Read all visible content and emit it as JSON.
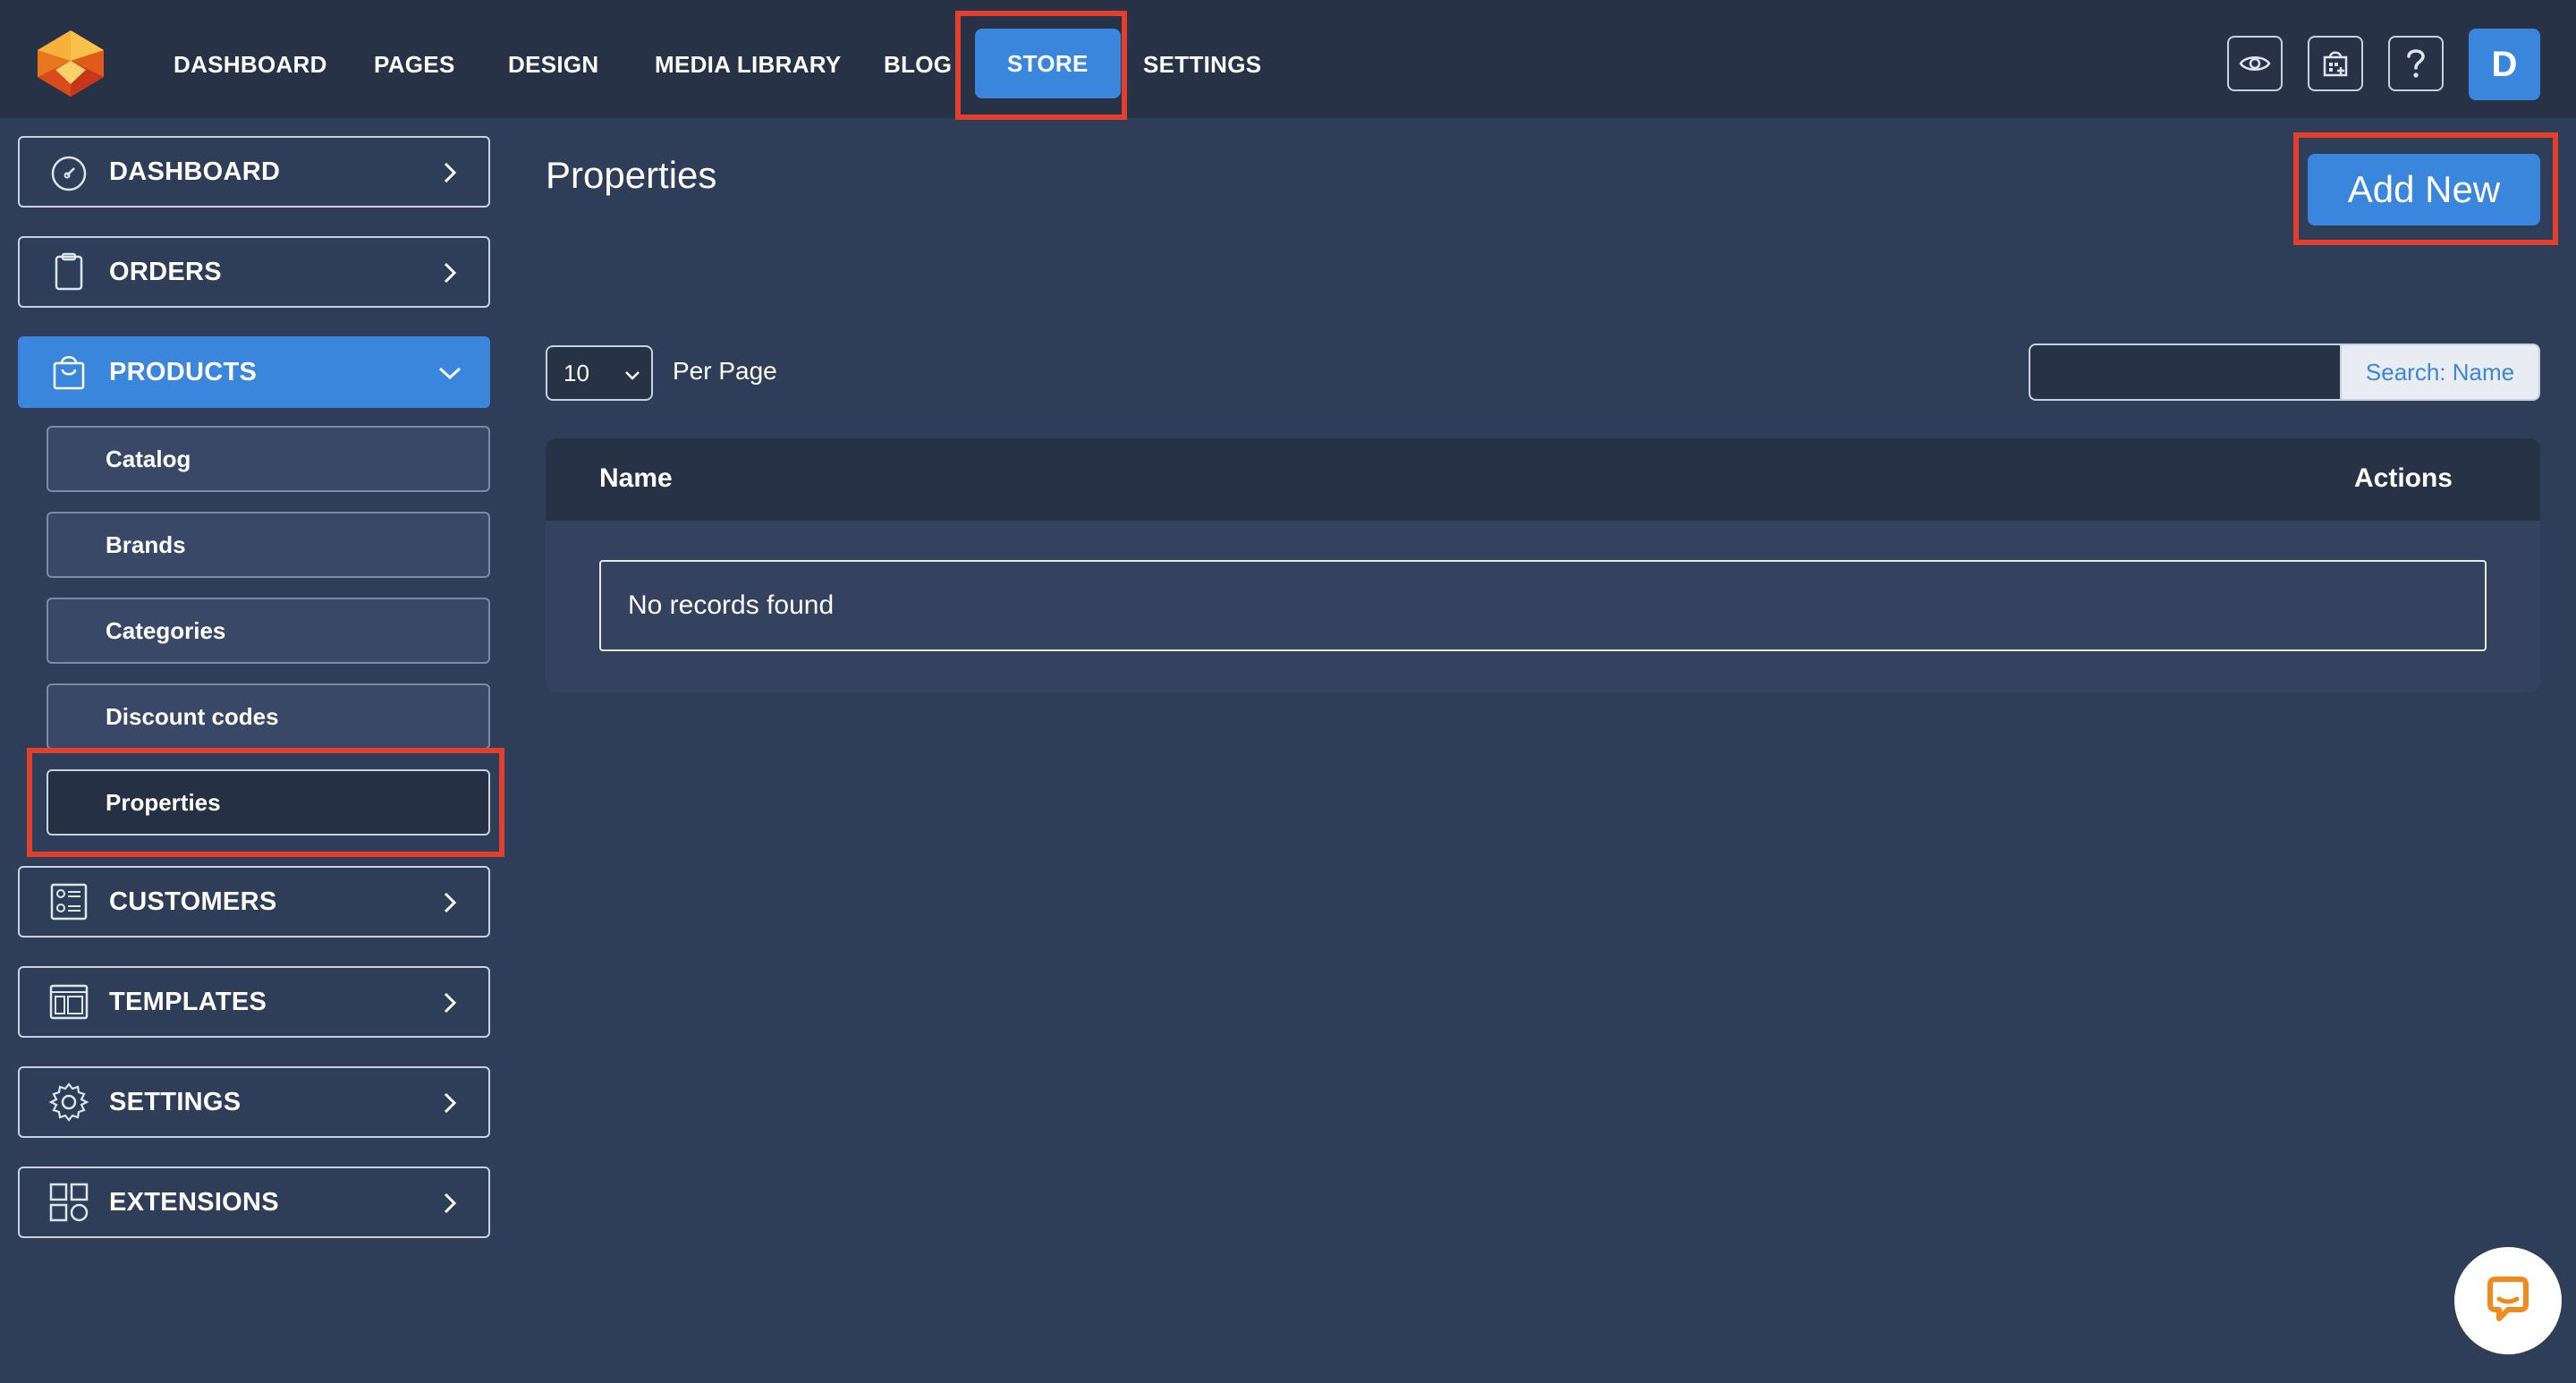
{
  "topnav": {
    "items": [
      {
        "label": "DASHBOARD"
      },
      {
        "label": "PAGES"
      },
      {
        "label": "DESIGN"
      },
      {
        "label": "MEDIA LIBRARY"
      },
      {
        "label": "BLOG"
      },
      {
        "label": "STORE",
        "active": true
      },
      {
        "label": "SETTINGS"
      }
    ],
    "icons": [
      "eye-icon",
      "store-calendar-icon",
      "help-icon"
    ],
    "avatar_initial": "D"
  },
  "sidebar": {
    "items": [
      {
        "label": "DASHBOARD",
        "icon": "gauge-icon"
      },
      {
        "label": "ORDERS",
        "icon": "clipboard-icon"
      },
      {
        "label": "PRODUCTS",
        "icon": "shopping-bag-icon",
        "expanded": true
      },
      {
        "label": "CUSTOMERS",
        "icon": "contact-card-icon"
      },
      {
        "label": "TEMPLATES",
        "icon": "layout-icon"
      },
      {
        "label": "SETTINGS",
        "icon": "gear-icon"
      },
      {
        "label": "EXTENSIONS",
        "icon": "grid-shapes-icon"
      }
    ],
    "products_sub": [
      {
        "label": "Catalog"
      },
      {
        "label": "Brands"
      },
      {
        "label": "Categories"
      },
      {
        "label": "Discount codes"
      },
      {
        "label": "Properties",
        "active": true
      }
    ]
  },
  "main": {
    "title": "Properties",
    "add_new_label": "Add New",
    "per_page_value": "10",
    "per_page_label": "Per Page",
    "search_value": "",
    "search_button_label": "Search: Name",
    "table": {
      "columns": [
        "Name",
        "Actions"
      ],
      "empty_message": "No records found"
    }
  },
  "colors": {
    "accent": "#3b86dd",
    "background": "#2f3e58",
    "topbar": "#273246",
    "highlight": "#e2402f",
    "logo_orange": "#f5a623"
  }
}
